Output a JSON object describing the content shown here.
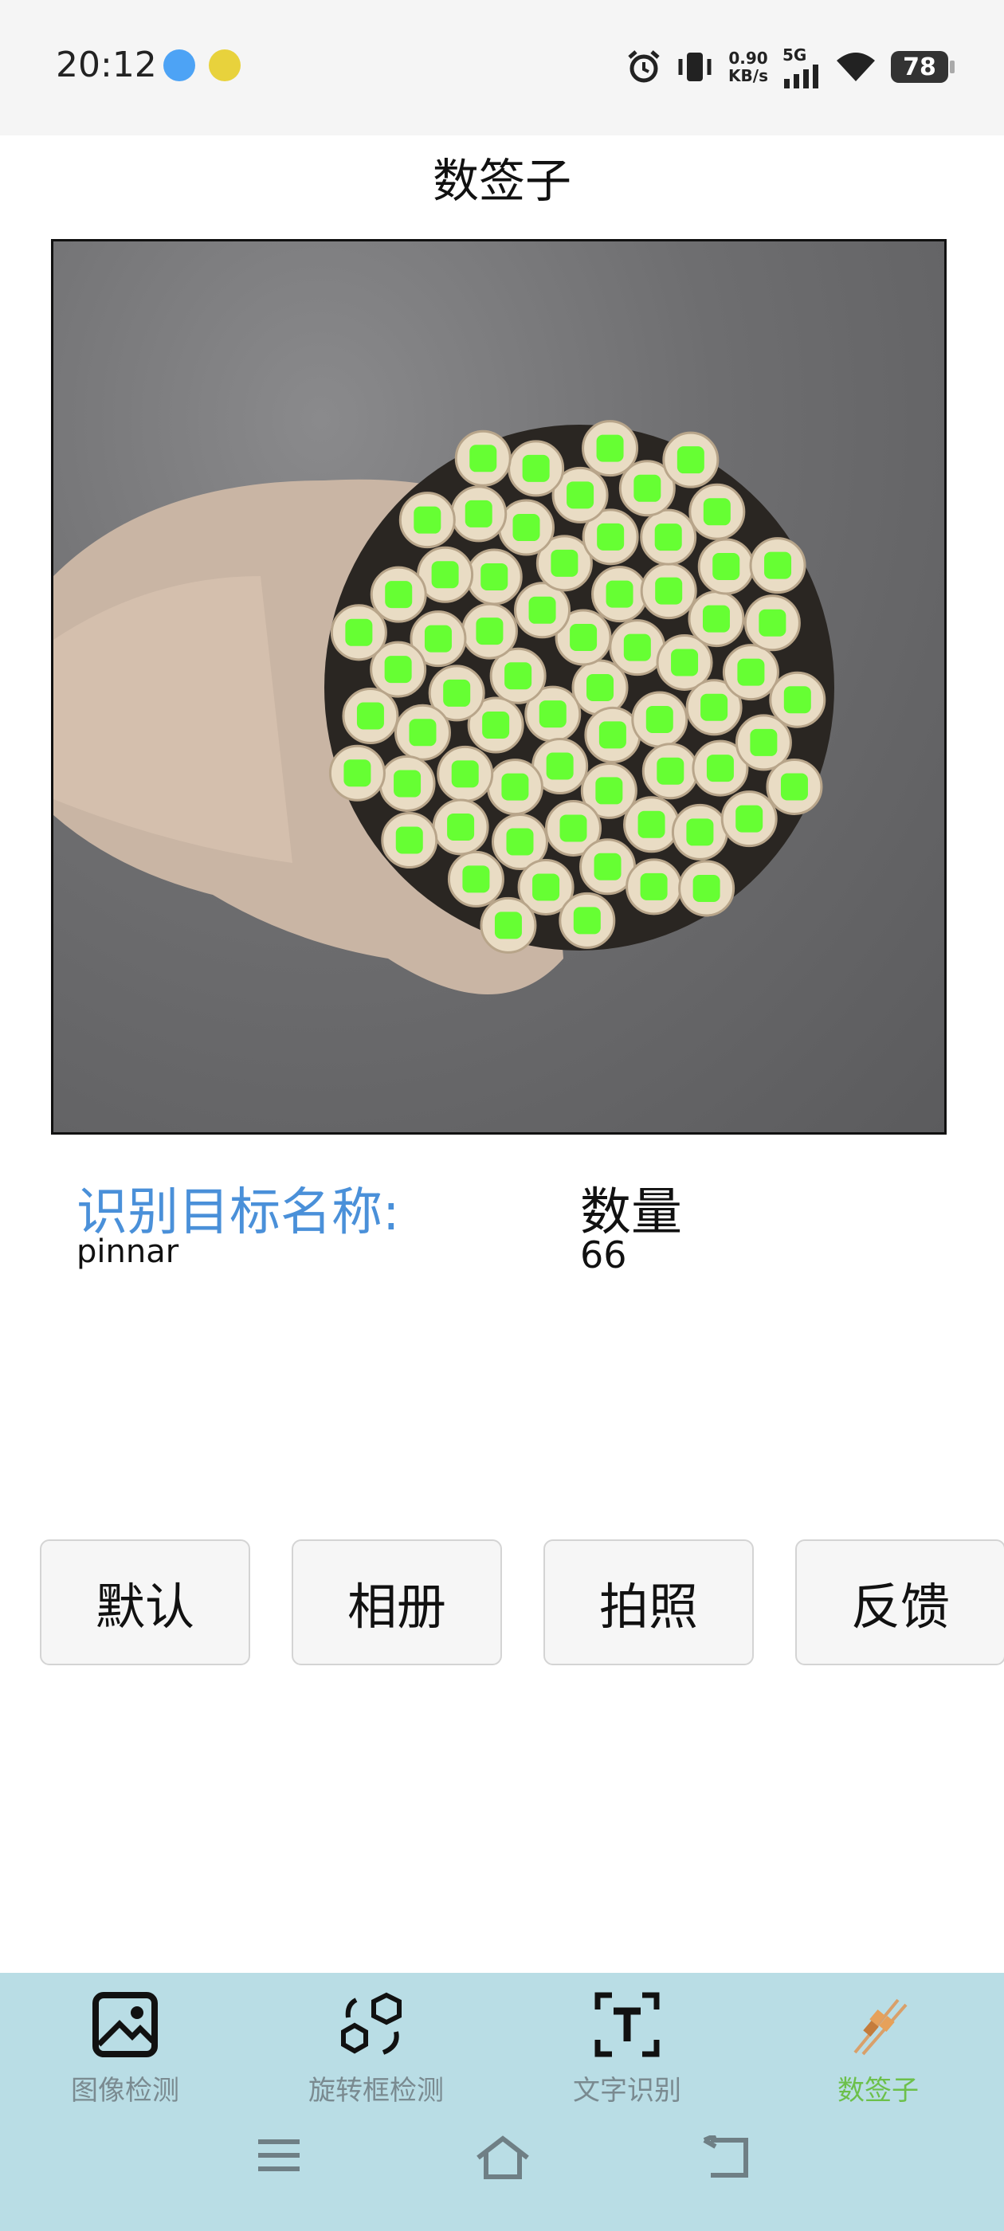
{
  "status_bar": {
    "time": "20:12",
    "speed_value": "0.90",
    "speed_unit": "KB/s",
    "network": "5G",
    "battery": "78",
    "icons": [
      "telegram-icon",
      "app-icon",
      "alarm-icon",
      "vibrate-icon",
      "signal-icon",
      "wifi-icon",
      "battery-icon"
    ]
  },
  "header": {
    "title": "数签子"
  },
  "result": {
    "name_label": "识别目标名称:",
    "name_value": "pinnar",
    "count_label": "数量",
    "count_value": "66"
  },
  "buttons": {
    "default": "默认",
    "album": "相册",
    "camera": "拍照",
    "feedback": "反馈"
  },
  "bottom_nav": {
    "items": [
      {
        "label": "图像检测",
        "icon": "image-icon"
      },
      {
        "label": "旋转框检测",
        "icon": "rotate-box-icon"
      },
      {
        "label": "文字识别",
        "icon": "text-recognition-icon"
      },
      {
        "label": "数签子",
        "icon": "skewer-icon",
        "active": true
      }
    ]
  },
  "system_nav": [
    "menu-icon",
    "home-icon",
    "back-icon"
  ],
  "colors": {
    "accent_blue": "#4a90d9",
    "detection_green": "#66ff33",
    "nav_bg": "#b9dde5",
    "active_green": "#6cc04a"
  }
}
